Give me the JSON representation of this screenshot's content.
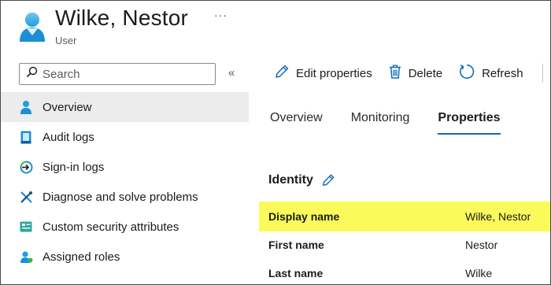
{
  "header": {
    "title": "Wilke, Nestor",
    "subtitle": "User",
    "more_label": "···"
  },
  "sidebar": {
    "search_placeholder": "Search",
    "collapse_label": "«",
    "items": [
      {
        "label": "Overview",
        "icon": "user-icon",
        "active": true
      },
      {
        "label": "Audit logs",
        "icon": "audit-log-icon",
        "active": false
      },
      {
        "label": "Sign-in logs",
        "icon": "sign-in-icon",
        "active": false
      },
      {
        "label": "Diagnose and solve problems",
        "icon": "wrench-icon",
        "active": false
      },
      {
        "label": "Custom security attributes",
        "icon": "attributes-icon",
        "active": false
      },
      {
        "label": "Assigned roles",
        "icon": "user-role-icon",
        "active": false
      }
    ]
  },
  "toolbar": {
    "edit_label": "Edit properties",
    "delete_label": "Delete",
    "refresh_label": "Refresh"
  },
  "tabs": [
    {
      "label": "Overview",
      "active": false
    },
    {
      "label": "Monitoring",
      "active": false
    },
    {
      "label": "Properties",
      "active": true
    }
  ],
  "properties": {
    "section_title": "Identity",
    "rows": [
      {
        "key": "Display name",
        "value": "Wilke, Nestor",
        "highlighted": true
      },
      {
        "key": "First name",
        "value": "Nestor",
        "highlighted": false
      },
      {
        "key": "Last name",
        "value": "Wilke",
        "highlighted": false
      }
    ]
  },
  "colors": {
    "accent": "#0f6cbd",
    "highlight": "#fafa5a",
    "active_nav_bg": "#ececec"
  }
}
